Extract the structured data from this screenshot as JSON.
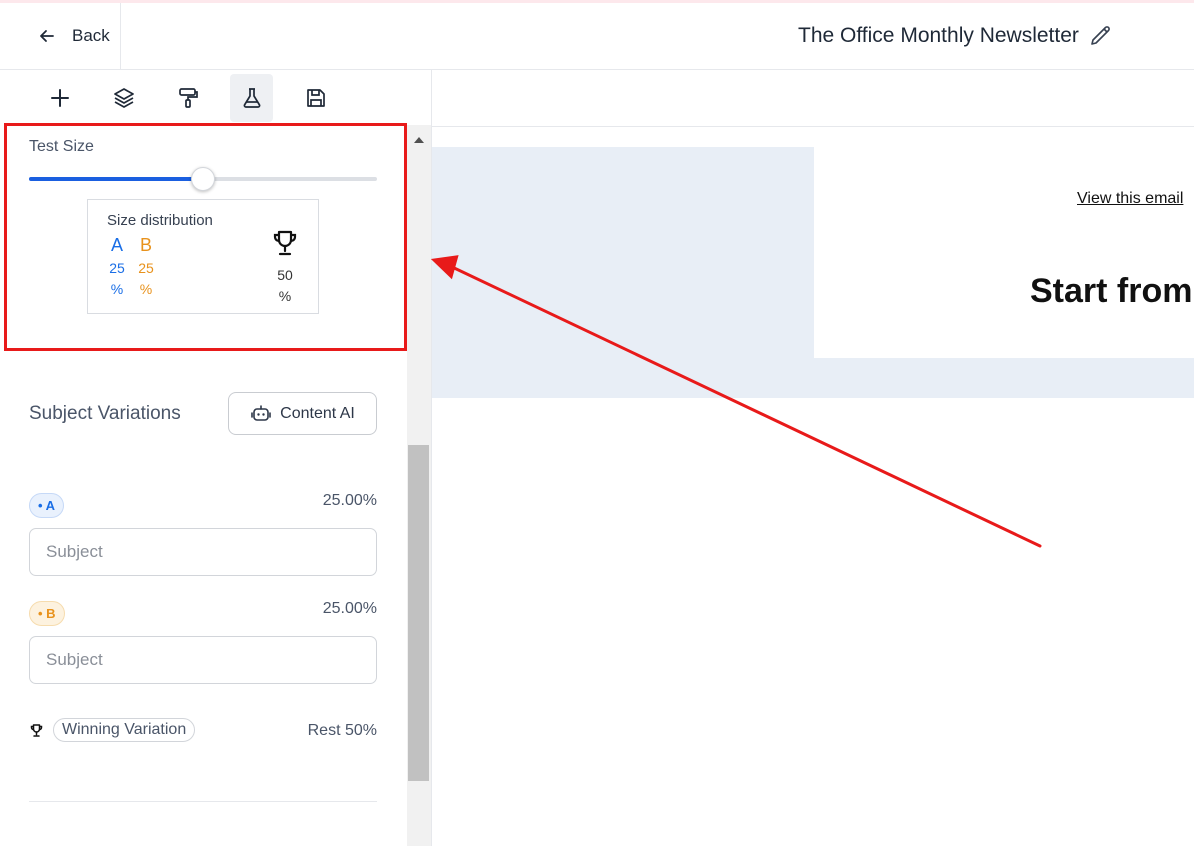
{
  "header": {
    "back_label": "Back",
    "doc_title": "The Office Monthly Newsletter"
  },
  "toolbar": {
    "tools": [
      {
        "icon": "plus-icon"
      },
      {
        "icon": "layers-icon"
      },
      {
        "icon": "paint-roller-icon"
      },
      {
        "icon": "flask-icon",
        "active": true
      },
      {
        "icon": "save-icon"
      }
    ]
  },
  "test_size": {
    "label": "Test Size",
    "slider_value_percent": 50,
    "distribution": {
      "title": "Size distribution",
      "a_letter": "A",
      "b_letter": "B",
      "a_value": "25",
      "b_value": "25",
      "winner_value": "50",
      "pct_sign": "%"
    }
  },
  "subject_variations": {
    "heading": "Subject Variations",
    "content_ai_label": "Content AI",
    "variations": [
      {
        "badge": "• A",
        "percent": "25.00%",
        "placeholder": "Subject"
      },
      {
        "badge": "• B",
        "percent": "25.00%",
        "placeholder": "Subject"
      }
    ],
    "winning_label": "Winning Variation",
    "rest_label": "Rest 50%"
  },
  "canvas": {
    "view_email_text": "View this email",
    "headline": "Start from"
  },
  "colors": {
    "accent_blue": "#1a5fe0",
    "variant_a": "#1a6ee6",
    "variant_b": "#e8921c",
    "annotation_red": "#e81a1a"
  }
}
